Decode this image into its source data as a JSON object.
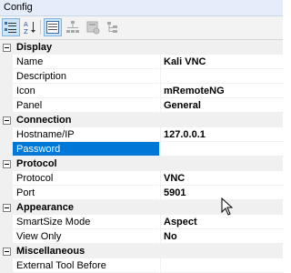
{
  "window": {
    "title": "Config"
  },
  "categories": [
    {
      "title": "Display",
      "properties": [
        {
          "name": "Name",
          "value": "Kali VNC"
        },
        {
          "name": "Description",
          "value": ""
        },
        {
          "name": "Icon",
          "value": "mRemoteNG"
        },
        {
          "name": "Panel",
          "value": "General"
        }
      ]
    },
    {
      "title": "Connection",
      "properties": [
        {
          "name": "Hostname/IP",
          "value": "127.0.0.1"
        },
        {
          "name": "Password",
          "value": ""
        }
      ]
    },
    {
      "title": "Protocol",
      "properties": [
        {
          "name": "Protocol",
          "value": "VNC"
        },
        {
          "name": "Port",
          "value": "5901"
        }
      ]
    },
    {
      "title": "Appearance",
      "properties": [
        {
          "name": "SmartSize Mode",
          "value": "Aspect"
        },
        {
          "name": "View Only",
          "value": "No"
        }
      ]
    },
    {
      "title": "Miscellaneous",
      "properties": [
        {
          "name": "External Tool Before",
          "value": ""
        }
      ]
    }
  ],
  "selected_property": "Password",
  "colors": {
    "selection": "#0078d7",
    "category_bg": "#f0f0f0",
    "titlebar_bg": "#e4edf9"
  },
  "icons": [
    "categorized-icon",
    "alphabetical-sort-icon",
    "property-pages-icon",
    "hierarchy-icon",
    "host-status-icon",
    "child-hierarchy-icon",
    "toggle-collapse-icon",
    "mouse-cursor-icon"
  ]
}
